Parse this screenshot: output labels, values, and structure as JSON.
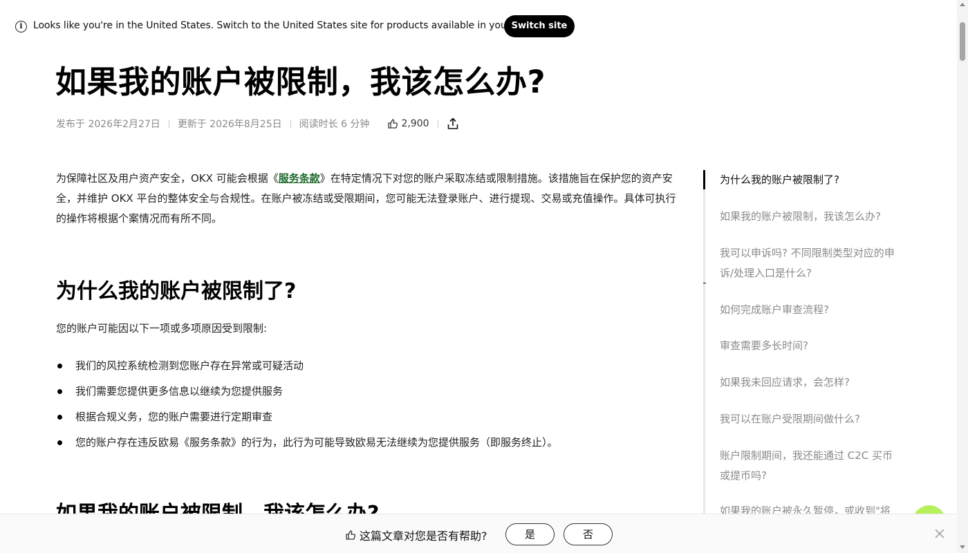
{
  "banner": {
    "info_icon": "info-circle-icon",
    "text": "Looks like you're in the United States. Switch to the United States site for products available in your region.",
    "switch_label": "Switch site"
  },
  "article": {
    "title": "如果我的账户被限制，我该怎么办?",
    "meta": {
      "published": "发布于 2026年2月27日",
      "updated": "更新于 2026年8月25日",
      "read_time": "阅读时长 6 分钟",
      "likes": "2,900",
      "like_icon": "thumbs-up-icon",
      "share_icon": "share-icon"
    },
    "intro": {
      "before_link": "为保障社区及用户资产安全，OKX 可能会根据《",
      "link_text": "服务条款",
      "after_link": "》在特定情况下对您的账户采取冻结或限制措施。该措施旨在保护您的资产安全，并维护 OKX 平台的整体安全与合规性。在账户被冻结或受限期间，您可能无法登录账户、进行提现、交易或充值操作。具体可执行的操作将根据个案情况而有所不同。"
    },
    "section1": {
      "heading": "为什么我的账户被限制了?",
      "lead": "您的账户可能因以下一项或多项原因受到限制:",
      "bullets": [
        "我们的风控系统检测到您账户存在异常或可疑活动",
        "我们需要您提供更多信息以继续为您提供服务",
        "根据合规义务，您的账户需要进行定期审查",
        "您的账户存在违反欧易《服务条款》的行为，此行为可能导致欧易无法继续为您提供服务（即服务终止）。"
      ]
    },
    "section2": {
      "heading": "如果我的账户被限制，我该怎么办?"
    }
  },
  "toc": {
    "items": [
      "为什么我的账户被限制了?",
      "如果我的账户被限制，我该怎么办?",
      "我可以申诉吗? 不同限制类型对应的申诉/处理入口是什么?",
      "如何完成账户审查流程?",
      "审查需要多长时间?",
      "如果我未回应请求，会怎样?",
      "我可以在账户受限期间做什么?",
      "账户限制期间，我还能通过 C2C 买币或提币吗?",
      "如果我的账户被永久暂停，或收到\"将"
    ],
    "active_index": 0
  },
  "feedback": {
    "question": "这篇文章对您是否有帮助?",
    "yes_label": "是",
    "no_label": "否",
    "close_icon": "close-icon"
  },
  "colors": {
    "link": "#1f6b2d",
    "chat_bubble": "#b6f05a",
    "muted": "#8a8a8a"
  }
}
